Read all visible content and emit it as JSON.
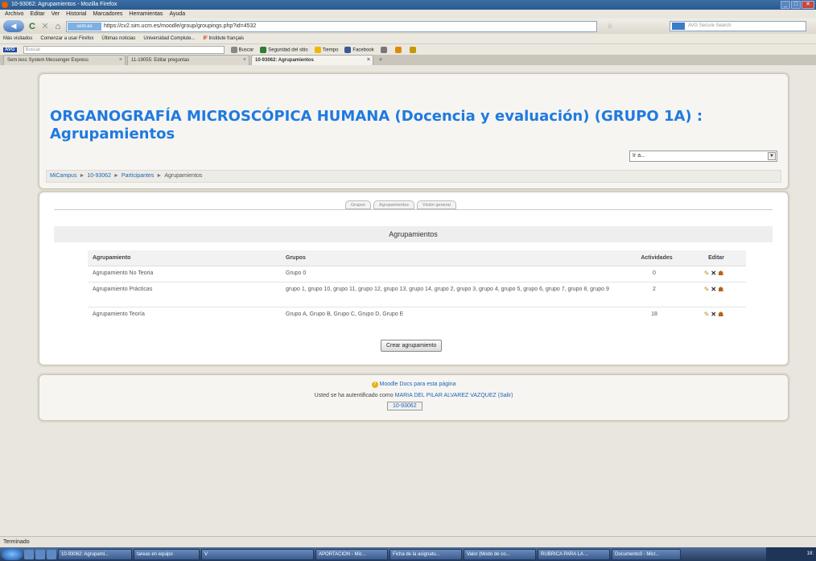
{
  "window": {
    "title": "10-93062: Agrupamientos - Mozilla Firefox"
  },
  "menu": [
    "Archivo",
    "Editar",
    "Ver",
    "Historial",
    "Marcadores",
    "Herramientas",
    "Ayuda"
  ],
  "nav": {
    "site_badge": "ucm.es",
    "url": "https://cv2.sim.ucm.es/moodle/group/groupings.php?id=4532",
    "search_placeholder": "AVG Secure Search"
  },
  "bookmarks": [
    "Más visitados",
    "Comenzar a usar Firefox",
    "Últimas noticias",
    "Universidad Complute...",
    "IF",
    "Institute français"
  ],
  "avg_toolbar": {
    "logo": "AVG",
    "search_placeholder": "Buscar",
    "items": [
      "Buscar",
      "Seguridad del sitio",
      "Tiempo",
      "Facebook"
    ]
  },
  "tabs": [
    {
      "label": "Sem.less System Messenger Express"
    },
    {
      "label": "11-19055: Editar preguntas"
    },
    {
      "label": "10-93062: Agrupamientos"
    }
  ],
  "page": {
    "course_title_line1": "ORGANOGRAFÍA MICROSCÓPICA HUMANA (Docencia y evaluación) (GRUPO 1A) :",
    "course_title_line2": "Agrupamientos",
    "jump_select_value": "Ir a...",
    "breadcrumb": [
      "MiCampus",
      "10-93062",
      "Participantes",
      "Agrupamientos"
    ],
    "group_tabs": [
      "Grupos",
      "Agrupamientos",
      "Visión general"
    ],
    "table_title": "Agrupamientos",
    "table_headers": {
      "grouping": "Agrupamiento",
      "groups": "Grupos",
      "activities": "Actividades",
      "edit": "Editar"
    },
    "rows": [
      {
        "grouping": "Agrupamiento No Teoria",
        "groups": "Grupo 0",
        "activities": "0"
      },
      {
        "grouping": "Agrupamiento Prácticas",
        "groups": "grupo 1, grupo 10, grupo 11, grupo 12, grupo 13, grupo 14, grupo 2, grupo 3, grupo 4, grupo 5, grupo 6, grupo 7, grupo 8, grupo 9",
        "activities": "2"
      },
      {
        "grouping": "Agrupamiento Teoría",
        "groups": "Grupo A, Grupo B, Grupo C, Grupo D, Grupo E",
        "activities": "18"
      }
    ],
    "create_button": "Crear agrupamiento"
  },
  "footer": {
    "moodle_docs": "Moodle Docs para esta página",
    "login_prefix": "Usted se ha autentificado como",
    "user_name": "MARIA DEL PILAR ALVAREZ VAZQUEZ",
    "logout": "(Salir)",
    "course_link": "10-93062"
  },
  "status": "Terminado",
  "taskbar": [
    "10-93062: Agrupami...",
    "tareas en equipo",
    "V",
    "APORTACION - Mic...",
    "Ficha de la asignatu...",
    "Valor (Modo de co...",
    "RUBRICA PARA LA ...",
    "Documento3 - Micr..."
  ],
  "clock": "18:"
}
